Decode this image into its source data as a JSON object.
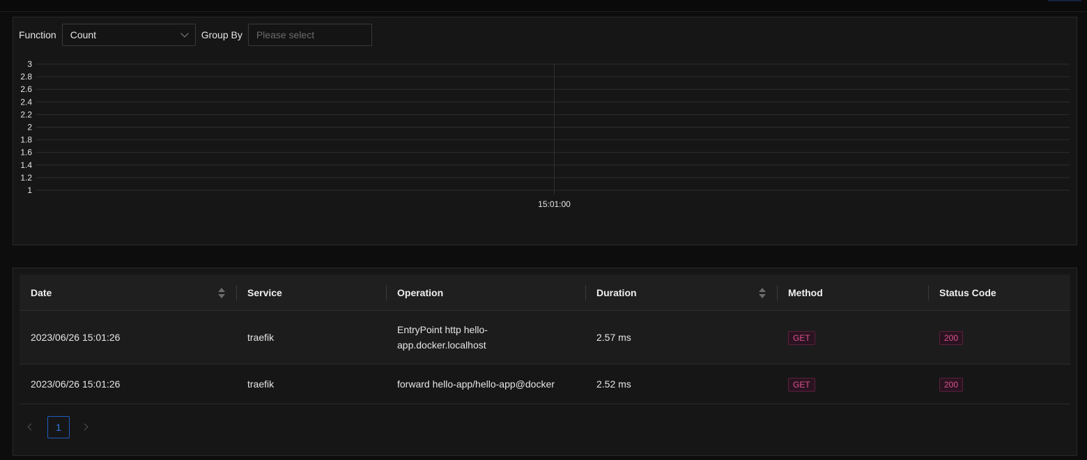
{
  "filters": {
    "function_label": "Function",
    "function_value": "Count",
    "group_by_label": "Group By",
    "group_by_placeholder": "Please select"
  },
  "chart_data": {
    "type": "line",
    "y_ticks": [
      "3",
      "2.8",
      "2.6",
      "2.4",
      "2.2",
      "2",
      "1.8",
      "1.6",
      "1.4",
      "1.2",
      "1"
    ],
    "ylim": [
      1,
      3
    ],
    "x_ticks": [
      "15:01:00"
    ],
    "grid": true,
    "series": []
  },
  "table": {
    "columns": [
      {
        "label": "Date",
        "sortable": true
      },
      {
        "label": "Service",
        "sortable": false
      },
      {
        "label": "Operation",
        "sortable": false
      },
      {
        "label": "Duration",
        "sortable": true
      },
      {
        "label": "Method",
        "sortable": false
      },
      {
        "label": "Status Code",
        "sortable": false
      }
    ],
    "rows": [
      {
        "date": "2023/06/26 15:01:26",
        "service": "traefik",
        "operation": "EntryPoint http hello-app.docker.localhost",
        "duration": "2.57 ms",
        "method": "GET",
        "status": "200"
      },
      {
        "date": "2023/06/26 15:01:26",
        "service": "traefik",
        "operation": "forward hello-app/hello-app@docker",
        "duration": "2.52 ms",
        "method": "GET",
        "status": "200"
      }
    ]
  },
  "pagination": {
    "current_page": "1"
  },
  "colors": {
    "background": "#0d0d0d",
    "panel": "#161616",
    "tag_text": "#d9538b",
    "tag_border": "#5c1f3c",
    "page_active": "#2f7be8"
  }
}
